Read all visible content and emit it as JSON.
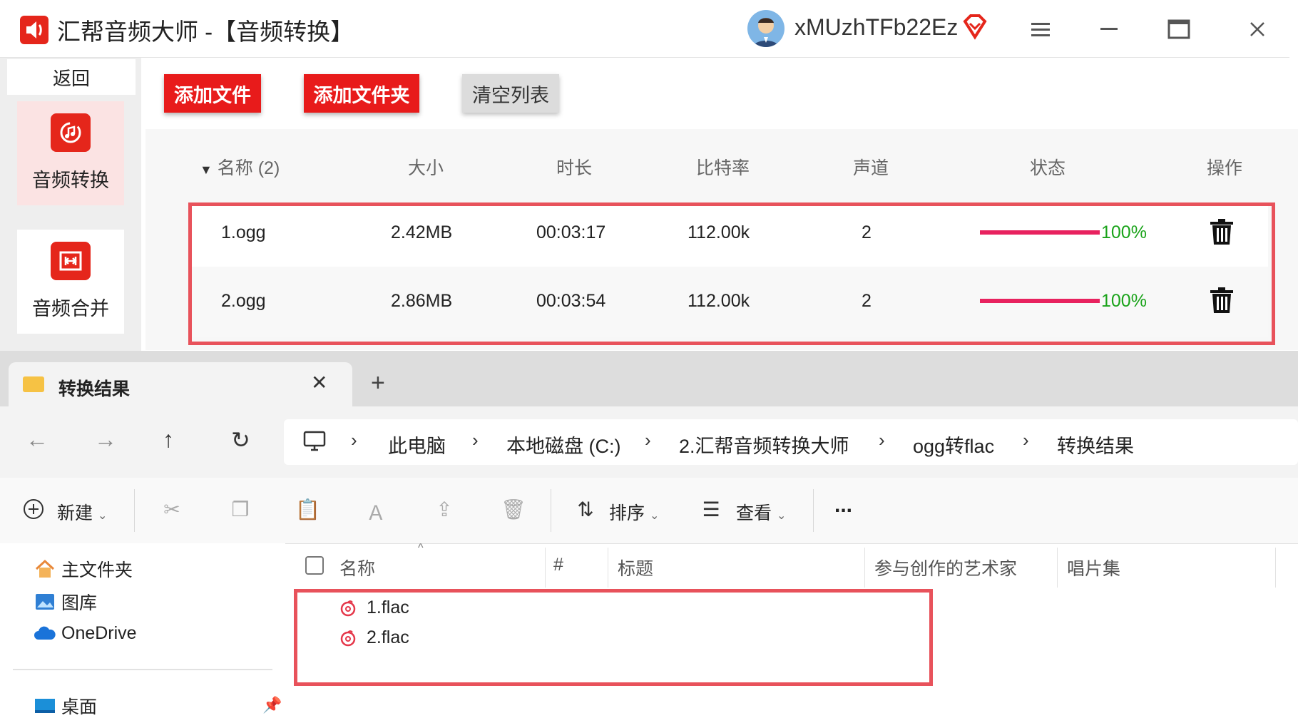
{
  "app": {
    "title": "汇帮音频大师 -【音频转换】",
    "username": "xMUzhTFb22Ez",
    "window_controls": [
      "menu-icon",
      "minimize-icon",
      "maximize-icon",
      "close-icon"
    ],
    "brand_color": "#e81b1b"
  },
  "sidebar": {
    "back_label": "返回",
    "items": [
      {
        "label": "音频转换",
        "icon": "audio-convert-icon",
        "active": true
      },
      {
        "label": "音频合并",
        "icon": "audio-merge-icon",
        "active": false
      }
    ]
  },
  "toolbar": {
    "add_file": "添加文件",
    "add_folder": "添加文件夹",
    "clear_list": "清空列表"
  },
  "file_table": {
    "headers": [
      "名称 (2)",
      "大小",
      "时长",
      "比特率",
      "声道",
      "状态",
      "操作"
    ],
    "rows": [
      {
        "name": "1.ogg",
        "size": "2.42MB",
        "duration": "00:03:17",
        "bitrate": "112.00k",
        "channels": "2",
        "progress": 1.0,
        "status": "100%"
      },
      {
        "name": "2.ogg",
        "size": "2.86MB",
        "duration": "00:03:54",
        "bitrate": "112.00k",
        "channels": "2",
        "progress": 1.0,
        "status": "100%"
      }
    ],
    "progress_color": "#e8225f",
    "status_color": "#1aa31a"
  },
  "explorer": {
    "tab_title": "转换结果",
    "breadcrumb": [
      "此电脑",
      "本地磁盘 (C:)",
      "2.汇帮音频转换大师",
      "ogg转flac",
      "转换结果"
    ],
    "commands": {
      "new": "新建",
      "sort": "排序",
      "view": "查看",
      "more": "..."
    },
    "nav_items": [
      {
        "label": "主文件夹",
        "icon": "home-icon"
      },
      {
        "label": "图库",
        "icon": "gallery-icon"
      },
      {
        "label": "OneDrive",
        "icon": "cloud-icon"
      },
      {
        "label": "桌面",
        "icon": "desktop-icon"
      }
    ],
    "columns": [
      "名称",
      "#",
      "标题",
      "参与创作的艺术家",
      "唱片集"
    ],
    "files": [
      "1.flac",
      "2.flac"
    ]
  },
  "highlight_color": "#e8525b"
}
